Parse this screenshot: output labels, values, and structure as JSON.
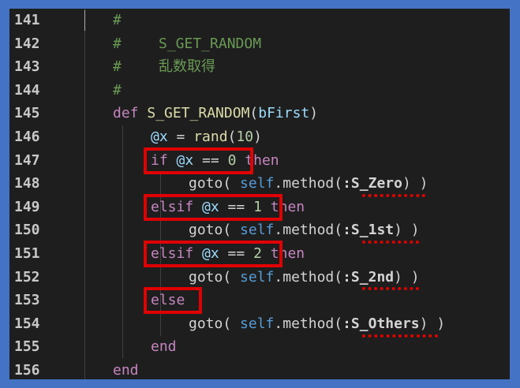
{
  "colors": {
    "frame": "#4472c4",
    "editor_bg": "#1e1e1e",
    "highlight": "#e00000",
    "comment": "#6a9955",
    "keyword": "#c586c0",
    "function": "#dcdcaa",
    "variable": "#9cdcfe",
    "self": "#569cd6",
    "number": "#b5cea8"
  },
  "lines": [
    {
      "number": "141",
      "indent": "#",
      "text": ""
    },
    {
      "number": "142",
      "text": "S_GET_RANDOM"
    },
    {
      "number": "143",
      "text": "乱数取得"
    },
    {
      "number": "144",
      "text": ""
    },
    {
      "number": "145",
      "def": "def",
      "name": "S_GET_RANDOM",
      "open": "(",
      "param": "bFirst",
      "close": ")"
    },
    {
      "number": "146",
      "ivar": "@x",
      "eq": " = ",
      "fn": "rand",
      "open": "(",
      "num": "10",
      "close": ")"
    },
    {
      "number": "147",
      "kw1": "if",
      "ivar": "@x",
      "op": " == ",
      "num": "0",
      "kw2": "then"
    },
    {
      "number": "148",
      "goto": "goto( ",
      "self": "self",
      "method": ".method(",
      "symbol": ":S_Zero",
      "close": ") )"
    },
    {
      "number": "149",
      "kw1": "elsif",
      "ivar": "@x",
      "op": " == ",
      "num": "1",
      "kw2": "then"
    },
    {
      "number": "150",
      "goto": "goto( ",
      "self": "self",
      "method": ".method(",
      "symbol": ":S_1st",
      "close": ") )"
    },
    {
      "number": "151",
      "kw1": "elsif",
      "ivar": "@x",
      "op": " == ",
      "num": "2",
      "kw2": "then"
    },
    {
      "number": "152",
      "goto": "goto( ",
      "self": "self",
      "method": ".method(",
      "symbol": ":S_2nd",
      "close": ") )"
    },
    {
      "number": "153",
      "kw1": "else"
    },
    {
      "number": "154",
      "goto": "goto( ",
      "self": "self",
      "method": ".method(",
      "symbol": ":S_Others",
      "close": ") )"
    },
    {
      "number": "155",
      "kw1": "end"
    },
    {
      "number": "156",
      "kw1": "end"
    }
  ],
  "comment_char": "#"
}
